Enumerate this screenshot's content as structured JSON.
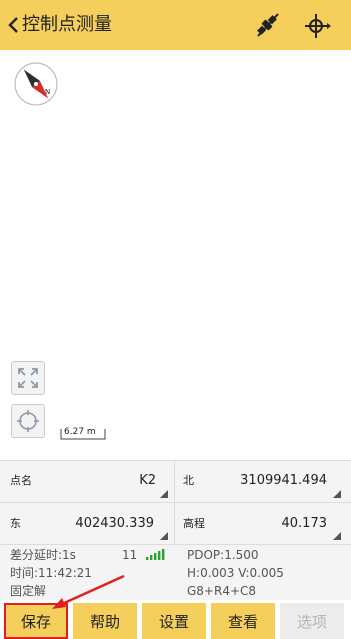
{
  "header": {
    "title": "控制点测量",
    "back_icon": "chevron-left-icon",
    "satellite_icon": "satellite-icon",
    "target_icon": "crosshair-target-icon",
    "bg_color": "#f5cf5b"
  },
  "map": {
    "compass_label": "N",
    "scale": "6.27 m"
  },
  "fields": {
    "point_name_label": "点名",
    "point_name_value": "K2",
    "north_label": "北",
    "north_value": "3109941.494",
    "east_label": "东",
    "east_value": "402430.339",
    "elevation_label": "高程",
    "elevation_value": "40.173"
  },
  "status": {
    "diff_delay": "差分延时:1s",
    "sat_count": "11",
    "time": "时间:11:42:21",
    "solution": "固定解",
    "pdop": "PDOP:1.500",
    "hv": "H:0.003  V:0.005",
    "constellation": "G8+R4+C8",
    "signal_color": "#2aa52a"
  },
  "buttons": {
    "save": "保存",
    "help": "帮助",
    "settings": "设置",
    "view": "查看",
    "options": "选项"
  },
  "annotation_color": "#e02020"
}
